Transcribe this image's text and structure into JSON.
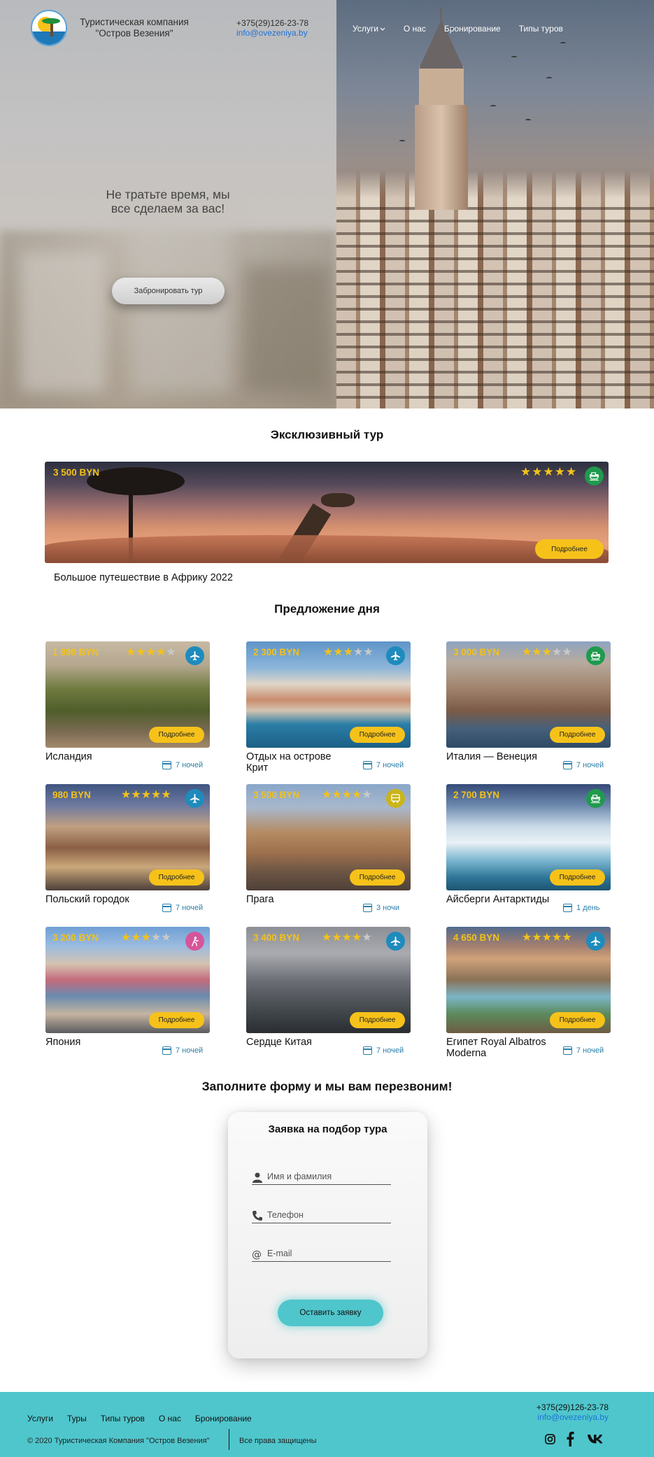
{
  "header": {
    "company_line1": "Туристическая компания",
    "company_line2": "\"Остров Везения\"",
    "phone": "+375(29)126-23-78",
    "email": "info@ovezeniya.by",
    "nav": [
      "Услуги",
      "О нас",
      "Бронирование",
      "Типы туров"
    ]
  },
  "hero": {
    "tagline_line1": "Не тратьте время, мы",
    "tagline_line2": "все сделаем за вас!",
    "button_label": "Забронировать тур"
  },
  "exclusive": {
    "heading": "Эксклюзивный тур",
    "price": "3 500 BYN",
    "rating": 5,
    "transport_icon": "ship-icon",
    "button_label": "Подробнее",
    "title": "Большое путешествие в Африку 2022"
  },
  "offers": {
    "heading": "Предложение дня",
    "button_label": "Подробнее",
    "items": [
      {
        "price": "1 890 BYN",
        "rating": 4,
        "transport_icon": "plane-icon",
        "title": "Исландия",
        "nights": "7 ночей"
      },
      {
        "price": "2 300 BYN",
        "rating": 3,
        "transport_icon": "plane-icon",
        "title": "Отдых на острове Крит",
        "nights": "7 ночей"
      },
      {
        "price": "3 000 BYN",
        "rating": 3,
        "transport_icon": "ship-icon",
        "title": "Италия — Венеция",
        "nights": "7 ночей"
      },
      {
        "price": "980 BYN",
        "rating": 5,
        "transport_icon": "plane-icon",
        "title": "Польский городок",
        "nights": "7 ночей"
      },
      {
        "price": "3 500 BYN",
        "rating": 4,
        "transport_icon": "bus-icon",
        "title": "Прага",
        "nights": "3 ночи"
      },
      {
        "price": "2 700 BYN",
        "rating": 0,
        "transport_icon": "ship-icon",
        "title": "Айсберги Антарктиды",
        "nights": "1 день"
      },
      {
        "price": "3 200 BYN",
        "rating": 3,
        "transport_icon": "hiking-icon",
        "title": "Япония",
        "nights": "7 ночей"
      },
      {
        "price": "3 400 BYN",
        "rating": 4,
        "transport_icon": "plane-icon",
        "title": "Сердце Китая",
        "nights": "7 ночей"
      },
      {
        "price": "4 650 BYN",
        "rating": 5,
        "transport_icon": "plane-icon",
        "title": "Египет Royal Albatros Moderna",
        "nights": "7 ночей"
      }
    ]
  },
  "form": {
    "heading": "Заполните форму и мы вам перезвоним!",
    "title": "Заявка на подбор тура",
    "name_placeholder": "Имя и фамилия",
    "phone_placeholder": "Телефон",
    "email_placeholder": "E-mail",
    "submit_label": "Оставить заявку"
  },
  "footer": {
    "nav": [
      "Услуги",
      "Туры",
      "Типы туров",
      "О нас",
      "Бронирование"
    ],
    "copyright": "© 2020 Туристическая Компания \"Остров Везения\"",
    "rights": "Все права защищены",
    "phone": "+375(29)126-23-78",
    "email": "info@ovezeniya.by",
    "social": [
      "instagram-icon",
      "facebook-icon",
      "vk-icon"
    ]
  },
  "colors": {
    "accent_yellow": "#f6c21a",
    "footer_teal": "#4fc6cc",
    "link_blue": "#1d72d8",
    "nights_blue": "#2a7fa8"
  }
}
